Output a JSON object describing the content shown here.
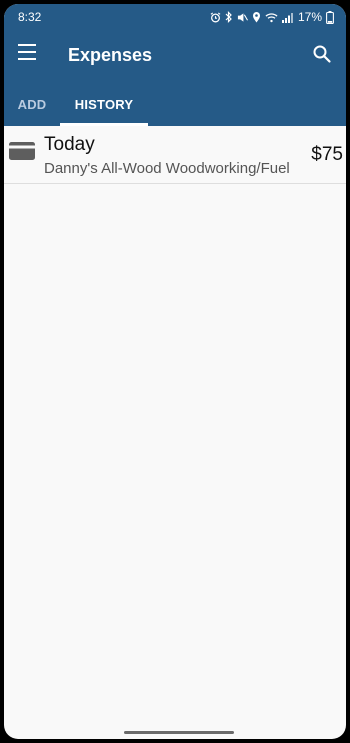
{
  "status_bar": {
    "time": "8:32",
    "battery": "17%",
    "icons": [
      "alarm-icon",
      "bluetooth-icon",
      "mute-icon",
      "location-icon",
      "wifi-icon",
      "signal-icon",
      "battery-icon"
    ]
  },
  "app_bar": {
    "title": "Expenses",
    "menu_icon": "menu-icon",
    "search_icon": "search-icon"
  },
  "tabs": [
    {
      "label": "ADD",
      "selected": false
    },
    {
      "label": "HISTORY",
      "selected": true
    }
  ],
  "history": [
    {
      "date": "Today",
      "description": "Danny's All-Wood Woodworking/Fuel",
      "amount": "$75",
      "icon": "credit-card-icon"
    }
  ],
  "colors": {
    "primary": "#255a87",
    "tab_inactive": "#b9cbe0",
    "background": "#f9f9f9"
  }
}
